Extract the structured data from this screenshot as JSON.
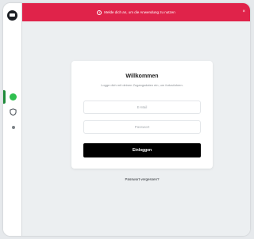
{
  "sidebar": {
    "logo": "chat-logo-icon",
    "items": [
      {
        "icon": "status-dot-icon",
        "color": "#2fbf4f"
      },
      {
        "icon": "shield-icon"
      },
      {
        "icon": "dot-icon"
      }
    ]
  },
  "banner": {
    "icon": "info-icon",
    "text": "Melde dich an, um die Anwendung zu nutzen",
    "close_label": "×",
    "color": "#e0234a"
  },
  "login": {
    "title": "Willkommen",
    "subtitle": "Logge dich mit deinen Zugangsdaten ein, um fortzufahren.",
    "email_placeholder": "E-Mail",
    "password_placeholder": "Passwort",
    "submit_label": "Einloggen",
    "forgot_label": "Passwort vergessen?"
  }
}
